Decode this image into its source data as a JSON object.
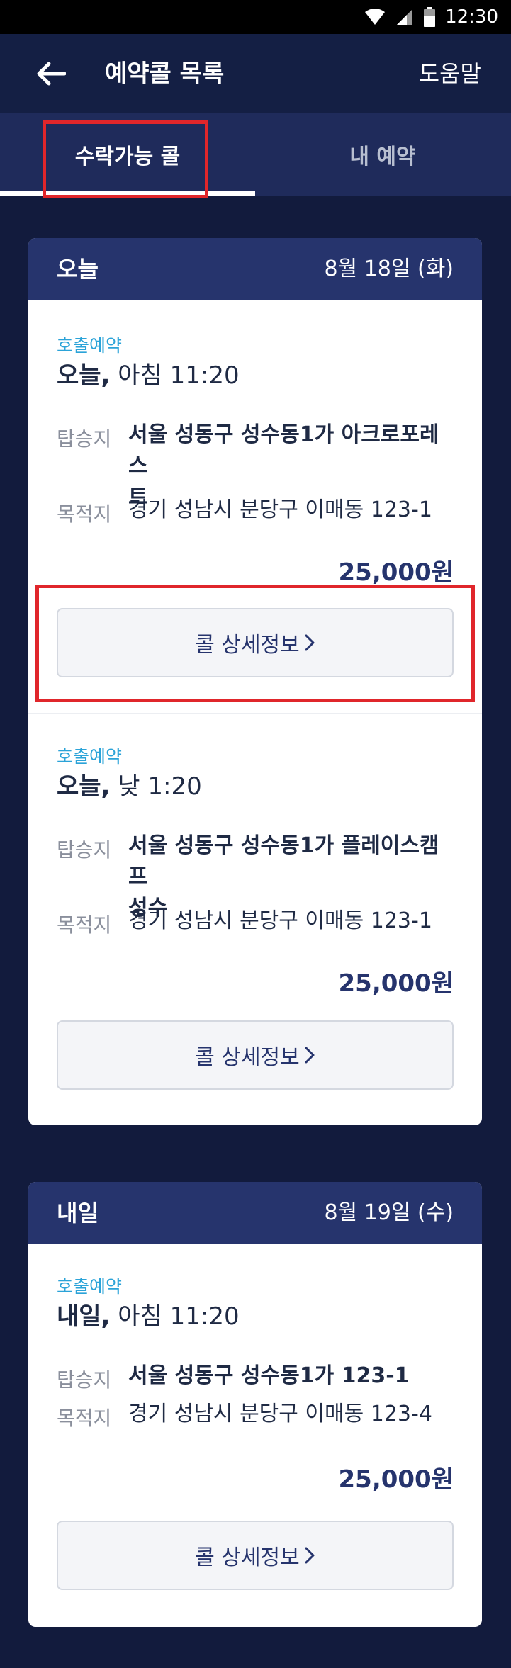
{
  "status_bar": {
    "time": "12:30"
  },
  "app_bar": {
    "title": "예약콜 목록",
    "help": "도움말"
  },
  "tabs": [
    {
      "label": "수락가능 콜",
      "selected": true
    },
    {
      "label": "내 예약",
      "selected": false
    }
  ],
  "days": [
    {
      "label": "오늘",
      "date": "8월 18일 (화)",
      "calls": [
        {
          "type": "호출예약",
          "day_word": "오늘,",
          "time": "아침 11:20",
          "pickup_label": "탑승지",
          "pickup_line1": "서울 성동구 성수동1가 아크로포레스",
          "pickup_line2": "트",
          "dest_label": "목적지",
          "destination": "경기 성남시 분당구 이매동 123-1",
          "price": "25,000원",
          "detail_label": "콜 상세정보"
        },
        {
          "type": "호출예약",
          "day_word": "오늘,",
          "time": "낮 1:20",
          "pickup_label": "탑승지",
          "pickup_line1": "서울 성동구 성수동1가 플레이스캠프",
          "pickup_line2": "성수",
          "dest_label": "목적지",
          "destination": "경기 성남시 분당구 이매동 123-1",
          "price": "25,000원",
          "detail_label": "콜 상세정보"
        }
      ]
    },
    {
      "label": "내일",
      "date": "8월 19일 (수)",
      "calls": [
        {
          "type": "호출예약",
          "day_word": "내일,",
          "time": "아침 11:20",
          "pickup_label": "탑승지",
          "pickup_line1": "서울 성동구 성수동1가 123-1",
          "dest_label": "목적지",
          "destination": "경기 성남시 분당구 이매동 123-4",
          "price": "25,000원",
          "detail_label": "콜 상세정보"
        }
      ]
    }
  ],
  "colors": {
    "background": "#121b3d",
    "header": "#26346d",
    "accent_blue": "#2ba3d8",
    "highlight_red": "#e0262b"
  }
}
